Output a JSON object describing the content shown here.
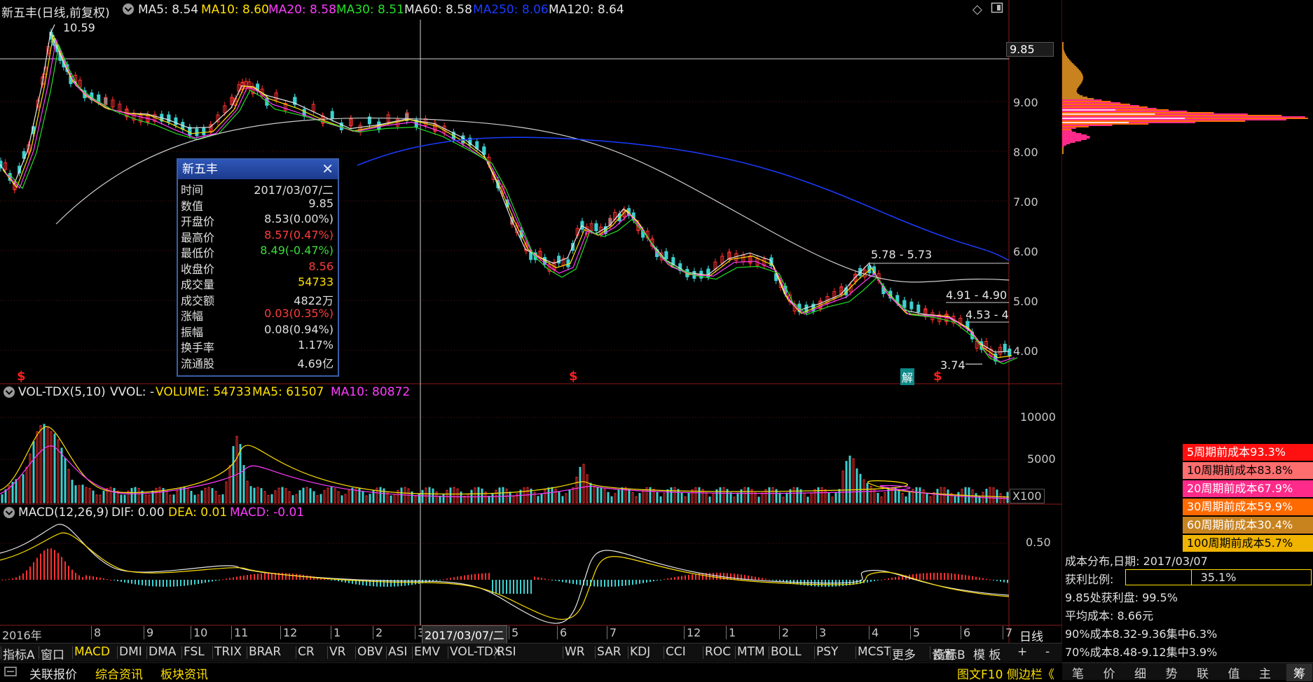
{
  "header": {
    "title": "新五丰(日线,前复权)",
    "ma5": "MA5: 8.54",
    "ma10": "MA10: 8.60",
    "ma20": "MA20: 8.58",
    "ma30": "MA30: 8.51",
    "ma60": "MA60: 8.58",
    "ma250": "MA250: 8.06",
    "ma120": "MA120: 8.64"
  },
  "price_axis": {
    "current": "9.85",
    "labels": [
      "9.00",
      "8.00",
      "7.00",
      "6.00",
      "5.00",
      "4.00"
    ]
  },
  "annotations": {
    "high": "10.59",
    "low": "3.74",
    "range1": "5.78 - 5.73",
    "range2": "4.91 - 4.90",
    "range3": "4.53 - 4",
    "marker_s": "$",
    "marker_jie": "解"
  },
  "popup": {
    "title": "新五丰",
    "rows": [
      {
        "k": "时间",
        "v": "2017/03/07/二",
        "color": "#e0e0e0"
      },
      {
        "k": "数值",
        "v": "9.85",
        "color": "#e0e0e0"
      },
      {
        "k": "开盘价",
        "v": "8.53(0.00%)",
        "color": "#e0e0e0"
      },
      {
        "k": "最高价",
        "v": "8.57(0.47%)",
        "color": "#ff3c3c"
      },
      {
        "k": "最低价",
        "v": "8.49(-0.47%)",
        "color": "#3cdc3c"
      },
      {
        "k": "收盘价",
        "v": "8.56",
        "color": "#ff3c3c"
      },
      {
        "k": "成交量",
        "v": "54733",
        "color": "#ffe000"
      },
      {
        "k": "成交额",
        "v": "4822万",
        "color": "#e0e0e0"
      },
      {
        "k": "涨幅",
        "v": "0.03(0.35%)",
        "color": "#ff3c3c"
      },
      {
        "k": "振幅",
        "v": "0.08(0.94%)",
        "color": "#e0e0e0"
      },
      {
        "k": "换手率",
        "v": "1.17%",
        "color": "#e0e0e0"
      },
      {
        "k": "流通股",
        "v": "4.69亿",
        "color": "#e0e0e0"
      }
    ]
  },
  "vol_pane": {
    "name": "VOL-TDX(5,10)",
    "vvol": "VVOL: -",
    "volume": "VOLUME: 54733",
    "ma5": "MA5: 61507",
    "ma10": "MA10: 80872",
    "labels": [
      "10000",
      "5000"
    ],
    "unit": "X100"
  },
  "macd_pane": {
    "name": "MACD(12,26,9)",
    "dif": "DIF: 0.00",
    "dea": "DEA: 0.01",
    "macd": "MACD: -0.01",
    "label": "0.50"
  },
  "time_axis": {
    "labels": [
      "2016年",
      "8",
      "9",
      "10",
      "11",
      "12",
      "1",
      "2",
      "3",
      "5",
      "6",
      "7",
      "12",
      "1",
      "2",
      "3",
      "4",
      "5",
      "6",
      "7"
    ],
    "cursor": "2017/03/07/二",
    "period": "日线"
  },
  "tabs": [
    "指标A",
    "窗口",
    "MACD",
    "DMI",
    "DMA",
    "FSL",
    "TRIX",
    "BRAR",
    "CR",
    "VR",
    "OBV",
    "ASI",
    "EMV",
    "VOL-TDX",
    "RSI",
    "WR",
    "SAR",
    "KDJ",
    "CCI",
    "ROC",
    "MTM",
    "BOLL",
    "PSY",
    "MCST",
    "更多",
    "设置"
  ],
  "tabs_right": [
    "指标B",
    "模 板",
    "+",
    "-"
  ],
  "status": {
    "items": [
      "关联报价",
      "综合资讯",
      "板块资讯"
    ],
    "right": "图文F10 侧边栏《"
  },
  "side_tabs": [
    "笔",
    "价",
    "细",
    "势",
    "联",
    "值",
    "主",
    "筹"
  ],
  "cost_legend": [
    {
      "label": "5周期前成本93.3%",
      "color": "#ff1010"
    },
    {
      "label": "10周期前成本83.8%",
      "color": "#ff6e6e"
    },
    {
      "label": "20周期前成本67.9%",
      "color": "#ff2a8a"
    },
    {
      "label": "30周期前成本59.9%",
      "color": "#ff6a00"
    },
    {
      "label": "60周期前成本30.4%",
      "color": "#c8821e"
    },
    {
      "label": "100周期前成本5.7%",
      "color": "#f0b400"
    }
  ],
  "cost_info": {
    "date": "成本分布,日期: 2017/03/07",
    "profit_label": "获利比例:",
    "profit_value": "35.1%",
    "profit_ratio": 0.351,
    "profit_at": "9.85处获利盘: 99.5%",
    "avg_cost": "平均成本: 8.66元",
    "c90": "90%成本8.32-9.36集中6.3%",
    "c70": "70%成本8.48-9.12集中3.9%"
  }
}
